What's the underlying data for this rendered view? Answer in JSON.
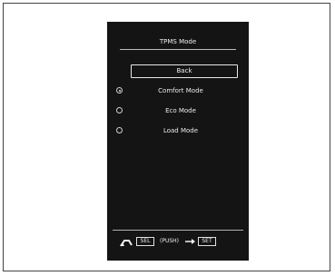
{
  "screen": {
    "title": "TPMS Mode",
    "back_label": "Back",
    "options": [
      {
        "label": "Comfort Mode",
        "selected": true
      },
      {
        "label": "Eco Mode",
        "selected": false
      },
      {
        "label": "Load Mode",
        "selected": false
      }
    ]
  },
  "footer": {
    "return_icon": "return-arrow-icon",
    "sel_label": "SEL",
    "push_label": "(PUSH)",
    "arrow_icon": "right-arrow-icon",
    "set_label": "SET"
  }
}
